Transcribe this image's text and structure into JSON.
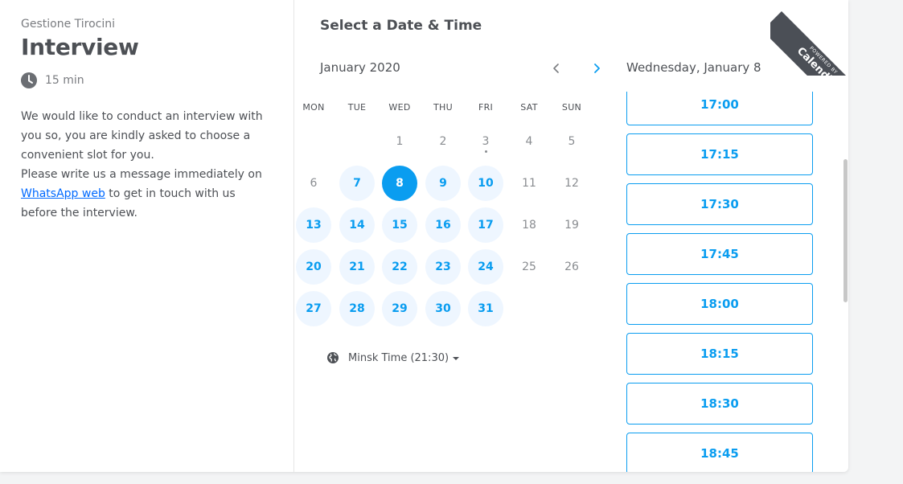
{
  "event": {
    "organizer": "Gestione Tirocini",
    "title": "Interview",
    "duration": "15 min",
    "description_line1": "We would like to conduct an interview with",
    "description_line2": "you so, you are kindly asked to choose a",
    "description_line3": "convenient slot for you.",
    "description_line4": "Please write us a message immediately on",
    "link_text": "WhatsApp web",
    "description_line5_rest": " to get in touch with us",
    "description_line6": "before the interview."
  },
  "calendar": {
    "heading": "Select a Date & Time",
    "month_label": "January 2020",
    "weekdays": [
      "MON",
      "TUE",
      "WED",
      "THU",
      "FRI",
      "SAT",
      "SUN"
    ],
    "selected_day": "8",
    "days": [
      {
        "d": "1",
        "state": "disabled"
      },
      {
        "d": "2",
        "state": "disabled"
      },
      {
        "d": "3",
        "state": "disabled"
      },
      {
        "d": "4",
        "state": "disabled"
      },
      {
        "d": "5",
        "state": "disabled"
      },
      {
        "d": "6",
        "state": "disabled"
      },
      {
        "d": "7",
        "state": "available"
      },
      {
        "d": "8",
        "state": "selected"
      },
      {
        "d": "9",
        "state": "available"
      },
      {
        "d": "10",
        "state": "available"
      },
      {
        "d": "11",
        "state": "disabled"
      },
      {
        "d": "12",
        "state": "disabled"
      },
      {
        "d": "13",
        "state": "available"
      },
      {
        "d": "14",
        "state": "available"
      },
      {
        "d": "15",
        "state": "available"
      },
      {
        "d": "16",
        "state": "available"
      },
      {
        "d": "17",
        "state": "available"
      },
      {
        "d": "18",
        "state": "disabled"
      },
      {
        "d": "19",
        "state": "disabled"
      },
      {
        "d": "20",
        "state": "available"
      },
      {
        "d": "21",
        "state": "available"
      },
      {
        "d": "22",
        "state": "available"
      },
      {
        "d": "23",
        "state": "available"
      },
      {
        "d": "24",
        "state": "available"
      },
      {
        "d": "25",
        "state": "disabled"
      },
      {
        "d": "26",
        "state": "disabled"
      },
      {
        "d": "27",
        "state": "available"
      },
      {
        "d": "28",
        "state": "available"
      },
      {
        "d": "29",
        "state": "available"
      },
      {
        "d": "30",
        "state": "available"
      },
      {
        "d": "31",
        "state": "available"
      }
    ],
    "first_weekday_index": 2,
    "today": "3",
    "timezone": "Minsk Time (21:30)"
  },
  "times": {
    "date_heading": "Wednesday, January 8",
    "slots": [
      "17:00",
      "17:15",
      "17:30",
      "17:45",
      "18:00",
      "18:15",
      "18:30",
      "18:45"
    ]
  },
  "branding": {
    "powered_by": "POWERED BY",
    "brand": "Calendly"
  },
  "colors": {
    "accent": "#0a9df0",
    "available_bg": "#eef6ff",
    "text": "#4d5055",
    "muted": "#8a8d91",
    "ribbon": "#4b4f56"
  }
}
